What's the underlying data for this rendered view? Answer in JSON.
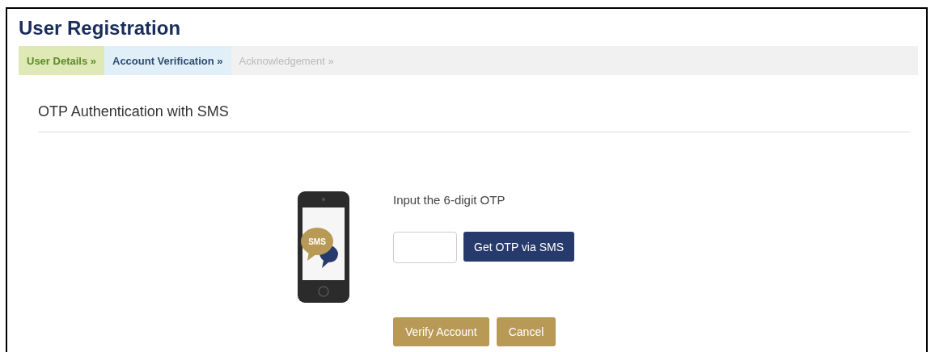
{
  "title": "User Registration",
  "steps": [
    {
      "label": "User Details »",
      "kind": "done"
    },
    {
      "label": "Account Verification »",
      "kind": "current"
    },
    {
      "label": "Acknowledgement »",
      "kind": "pending"
    }
  ],
  "section_title": "OTP Authentication with SMS",
  "phone_icon_text": "SMS",
  "otp_label": "Input the 6-digit OTP",
  "get_otp_button": "Get OTP via SMS",
  "buttons": [
    "Verify Account",
    "Cancel"
  ]
}
